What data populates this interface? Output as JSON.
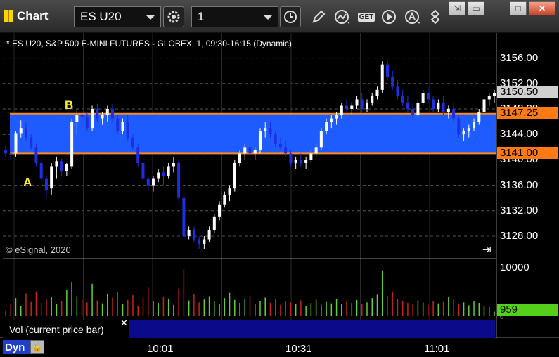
{
  "app": {
    "title": "Chart"
  },
  "toolbar": {
    "symbol": "ES U20",
    "interval": "1",
    "buttons": [
      "settings-icon",
      "clock-icon",
      "pencil-icon",
      "study-icon",
      "get-icon",
      "play-icon",
      "annotation-icon",
      "arrows-icon"
    ],
    "get_label": "GET",
    "window_buttons": [
      "restore",
      "minimize",
      "maximize",
      "close"
    ]
  },
  "chart": {
    "info_line": "* ES U20, S&P 500 E-MINI FUTURES - GLOBEX, 1, 09:30-16:15 (Dynamic)",
    "copyright": "© eSignal, 2020",
    "price_axis": [
      "3156.00",
      "3152.00",
      "3148.00",
      "3144.00",
      "3140.00",
      "3136.00",
      "3132.00",
      "3128.00"
    ],
    "current_price": "3150.50",
    "zone_high": "3147.25",
    "zone_low": "3141.00",
    "marker_a": "A",
    "marker_b": "B",
    "colors": {
      "zone": "#1f5cff",
      "zone_line": "#ff8a1c",
      "up": "#ffffff",
      "down": "#1f2fe0",
      "vol_up": "#5fcf3a",
      "vol_down": "#c8241c",
      "current_vol": "#55d01a"
    }
  },
  "volume": {
    "label": "Vol (current price bar)",
    "axis_top": "10000",
    "axis_zero": "0",
    "current": "959"
  },
  "timeaxis": {
    "labels": [
      "10:01",
      "10:31",
      "11:01"
    ]
  },
  "status": {
    "mode": "Dyn"
  },
  "chart_data": {
    "type": "candlestick",
    "title": "",
    "ylim": [
      3125,
      3159
    ],
    "zone": [
      3141.0,
      3147.25
    ],
    "bars": [
      [
        3141.5,
        3142.2,
        3140.5,
        3141.0
      ],
      [
        3141.0,
        3142.0,
        3140.0,
        3140.8
      ],
      [
        3141.0,
        3144.5,
        3140.5,
        3144.2
      ],
      [
        3144.2,
        3146.2,
        3143.5,
        3145.0
      ],
      [
        3145.0,
        3146.0,
        3143.0,
        3143.5
      ],
      [
        3143.5,
        3144.0,
        3141.5,
        3142.0
      ],
      [
        3142.0,
        3142.5,
        3139.0,
        3139.5
      ],
      [
        3139.5,
        3140.0,
        3136.5,
        3137.0
      ],
      [
        3137.0,
        3137.5,
        3134.0,
        3135.2
      ],
      [
        3135.5,
        3139.5,
        3134.5,
        3139.0
      ],
      [
        3139.0,
        3140.5,
        3137.0,
        3139.8
      ],
      [
        3139.8,
        3140.2,
        3137.5,
        3138.2
      ],
      [
        3138.2,
        3139.5,
        3137.5,
        3139.3
      ],
      [
        3139.0,
        3146.5,
        3138.5,
        3146.0
      ],
      [
        3146.0,
        3148.0,
        3144.0,
        3147.0
      ],
      [
        3147.0,
        3148.0,
        3145.0,
        3146.8
      ],
      [
        3146.8,
        3147.5,
        3144.5,
        3145.0
      ],
      [
        3145.0,
        3148.5,
        3144.5,
        3148.0
      ],
      [
        3148.0,
        3148.8,
        3146.0,
        3146.5
      ],
      [
        3146.5,
        3147.5,
        3145.5,
        3147.0
      ],
      [
        3147.0,
        3148.5,
        3146.0,
        3148.0
      ],
      [
        3148.0,
        3148.8,
        3146.0,
        3146.5
      ],
      [
        3146.5,
        3147.0,
        3144.0,
        3144.5
      ],
      [
        3144.5,
        3146.5,
        3144.0,
        3146.0
      ],
      [
        3146.0,
        3147.0,
        3143.0,
        3143.5
      ],
      [
        3143.5,
        3144.0,
        3141.5,
        3142.0
      ],
      [
        3142.0,
        3142.5,
        3139.0,
        3139.5
      ],
      [
        3139.5,
        3140.0,
        3136.5,
        3137.0
      ],
      [
        3137.0,
        3137.5,
        3135.0,
        3136.0
      ],
      [
        3136.0,
        3137.5,
        3135.0,
        3137.0
      ],
      [
        3137.0,
        3138.5,
        3136.5,
        3138.0
      ],
      [
        3138.0,
        3139.0,
        3136.0,
        3137.5
      ],
      [
        3137.5,
        3139.5,
        3137.0,
        3139.0
      ],
      [
        3139.0,
        3140.5,
        3138.0,
        3139.5
      ],
      [
        3139.5,
        3140.0,
        3133.5,
        3134.0
      ],
      [
        3134.0,
        3135.0,
        3127.0,
        3128.0
      ],
      [
        3128.0,
        3129.5,
        3127.5,
        3129.0
      ],
      [
        3129.0,
        3129.5,
        3127.0,
        3127.5
      ],
      [
        3127.5,
        3128.0,
        3126.0,
        3126.8
      ],
      [
        3126.8,
        3128.0,
        3126.0,
        3127.5
      ],
      [
        3127.5,
        3129.5,
        3127.0,
        3129.0
      ],
      [
        3129.0,
        3131.5,
        3128.5,
        3131.0
      ],
      [
        3131.0,
        3133.5,
        3130.5,
        3133.0
      ],
      [
        3133.0,
        3135.0,
        3132.5,
        3134.5
      ],
      [
        3134.5,
        3136.0,
        3133.5,
        3135.5
      ],
      [
        3135.5,
        3140.0,
        3135.0,
        3139.5
      ],
      [
        3139.5,
        3141.5,
        3139.0,
        3141.0
      ],
      [
        3141.0,
        3142.5,
        3140.0,
        3142.0
      ],
      [
        3142.0,
        3143.0,
        3140.5,
        3141.0
      ],
      [
        3141.0,
        3142.0,
        3140.0,
        3141.5
      ],
      [
        3141.5,
        3145.0,
        3141.0,
        3144.5
      ],
      [
        3144.5,
        3146.0,
        3143.5,
        3145.0
      ],
      [
        3145.0,
        3146.0,
        3143.5,
        3144.0
      ],
      [
        3144.0,
        3144.5,
        3142.0,
        3142.5
      ],
      [
        3142.5,
        3143.5,
        3141.5,
        3142.0
      ],
      [
        3142.0,
        3143.0,
        3140.5,
        3141.0
      ],
      [
        3141.0,
        3141.5,
        3139.0,
        3139.5
      ],
      [
        3139.5,
        3140.5,
        3138.5,
        3140.0
      ],
      [
        3140.0,
        3141.0,
        3139.0,
        3139.5
      ],
      [
        3139.5,
        3140.5,
        3138.5,
        3140.0
      ],
      [
        3140.0,
        3141.5,
        3139.5,
        3141.0
      ],
      [
        3141.0,
        3142.5,
        3140.5,
        3142.0
      ],
      [
        3142.0,
        3145.0,
        3141.5,
        3144.5
      ],
      [
        3144.5,
        3146.5,
        3144.0,
        3146.0
      ],
      [
        3146.0,
        3147.0,
        3145.0,
        3146.5
      ],
      [
        3146.5,
        3147.5,
        3145.5,
        3147.0
      ],
      [
        3147.0,
        3149.0,
        3146.5,
        3148.5
      ],
      [
        3148.5,
        3149.5,
        3147.5,
        3148.0
      ],
      [
        3148.0,
        3149.0,
        3147.0,
        3148.5
      ],
      [
        3148.5,
        3150.0,
        3148.0,
        3149.5
      ],
      [
        3149.5,
        3150.5,
        3147.5,
        3148.0
      ],
      [
        3148.0,
        3149.5,
        3147.5,
        3149.0
      ],
      [
        3149.0,
        3150.5,
        3148.5,
        3150.0
      ],
      [
        3150.0,
        3151.5,
        3149.5,
        3151.0
      ],
      [
        3151.0,
        3155.5,
        3150.5,
        3155.0
      ],
      [
        3155.0,
        3155.8,
        3152.5,
        3153.0
      ],
      [
        3153.0,
        3154.0,
        3151.0,
        3151.5
      ],
      [
        3151.5,
        3152.5,
        3149.5,
        3150.0
      ],
      [
        3150.0,
        3151.0,
        3148.5,
        3149.0
      ],
      [
        3149.0,
        3150.0,
        3147.5,
        3148.0
      ],
      [
        3148.0,
        3149.0,
        3146.5,
        3147.0
      ],
      [
        3147.0,
        3149.5,
        3146.5,
        3149.0
      ],
      [
        3149.0,
        3151.0,
        3148.5,
        3150.5
      ],
      [
        3150.5,
        3151.5,
        3149.0,
        3149.5
      ],
      [
        3149.5,
        3150.0,
        3147.5,
        3148.0
      ],
      [
        3148.0,
        3149.5,
        3147.5,
        3149.0
      ],
      [
        3149.0,
        3150.0,
        3147.0,
        3147.5
      ],
      [
        3147.5,
        3148.5,
        3146.5,
        3148.0
      ],
      [
        3148.0,
        3149.0,
        3146.0,
        3146.5
      ],
      [
        3146.5,
        3147.0,
        3143.5,
        3144.0
      ],
      [
        3144.0,
        3145.0,
        3143.0,
        3144.5
      ],
      [
        3144.5,
        3145.5,
        3143.5,
        3145.0
      ],
      [
        3145.0,
        3146.5,
        3144.5,
        3146.0
      ],
      [
        3146.0,
        3148.0,
        3145.5,
        3147.5
      ],
      [
        3147.5,
        3150.0,
        3147.0,
        3149.5
      ],
      [
        3149.5,
        3150.5,
        3148.5,
        3150.0
      ],
      [
        3150.0,
        3151.0,
        3149.0,
        3150.5
      ]
    ],
    "volume": [
      1200,
      2500,
      3800,
      2200,
      4800,
      3000,
      5200,
      2800,
      3600,
      4000,
      2600,
      3100,
      5600,
      7200,
      4200,
      3500,
      2900,
      6800,
      3300,
      2700,
      4600,
      3900,
      5100,
      2600,
      3400,
      4400,
      2200,
      3900,
      6000,
      3200,
      2800,
      4100,
      3600,
      2400,
      5800,
      9800,
      3300,
      4700,
      2900,
      3500,
      4200,
      3100,
      2600,
      3800,
      4900,
      3400,
      2800,
      3700,
      4300,
      2500,
      3200,
      3900,
      2800,
      3600,
      2400,
      3100,
      2900,
      2600,
      3300,
      2200,
      2800,
      3500,
      2400,
      3000,
      2700,
      3600,
      2500,
      3100,
      2800,
      3400,
      2600,
      2900,
      3800,
      4500,
      9600,
      4200,
      5200,
      3600,
      3100,
      2800,
      2500,
      3300,
      2900,
      2400,
      3200,
      2700,
      3000,
      4100,
      3500,
      2600,
      2900,
      2300,
      3100,
      2800,
      2200,
      1900,
      959
    ]
  }
}
